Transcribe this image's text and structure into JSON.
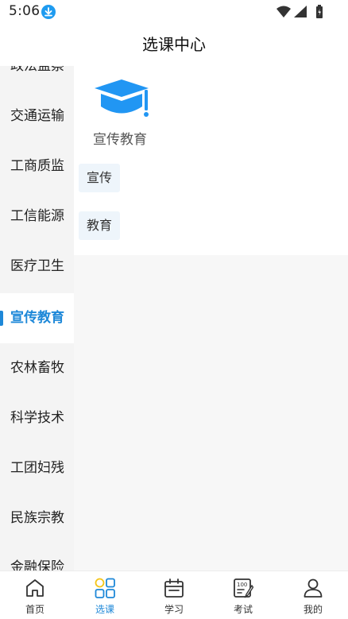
{
  "status_bar": {
    "time": "5:06",
    "icons": [
      "download-icon",
      "wifi-icon",
      "signal-icon",
      "battery-icon"
    ]
  },
  "header": {
    "title": "选课中心"
  },
  "sidebar": {
    "items": [
      {
        "label": "政法监察"
      },
      {
        "label": "交通运输"
      },
      {
        "label": "工商质监"
      },
      {
        "label": "工信能源"
      },
      {
        "label": "医疗卫生"
      },
      {
        "label": "宣传教育",
        "active": true
      },
      {
        "label": "农林畜牧"
      },
      {
        "label": "科学技术"
      },
      {
        "label": "工团妇残"
      },
      {
        "label": "民族宗教"
      },
      {
        "label": "金融保险"
      }
    ]
  },
  "content": {
    "category_icon": "graduation-cap-icon",
    "category_title": "宣传教育",
    "subcategories": [
      {
        "label": "宣传"
      },
      {
        "label": "教育"
      }
    ]
  },
  "tabbar": {
    "tabs": [
      {
        "label": "首页",
        "icon": "home-icon"
      },
      {
        "label": "选课",
        "icon": "grid-icon",
        "active": true
      },
      {
        "label": "学习",
        "icon": "calendar-icon"
      },
      {
        "label": "考试",
        "icon": "exam-icon"
      },
      {
        "label": "我的",
        "icon": "user-icon"
      }
    ]
  },
  "colors": {
    "accent": "#1e88d8",
    "icon_blue": "#2196f3",
    "active_grid_yellow": "#f5c518",
    "sidebar_bg": "#f4f4f4",
    "chip_bg": "#eef5fb"
  }
}
